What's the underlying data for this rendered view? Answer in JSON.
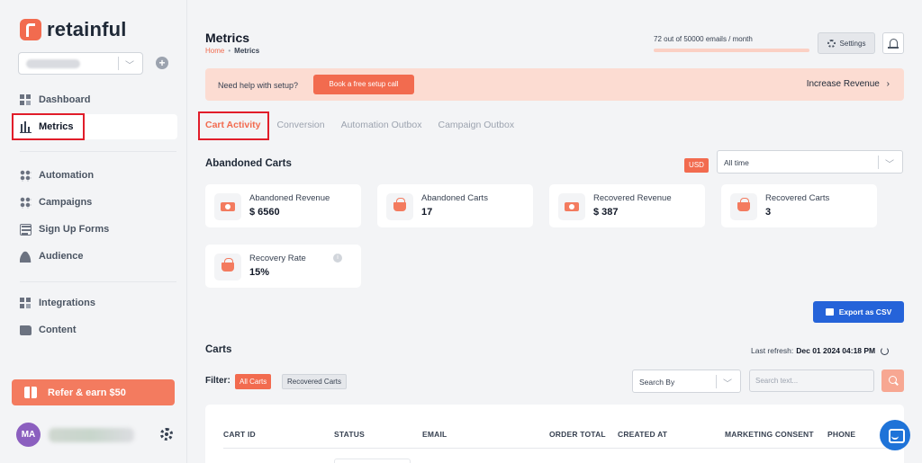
{
  "app": {
    "name": "retainful"
  },
  "sidebar": {
    "items": [
      {
        "label": "Dashboard",
        "icon": "dashboard-icon"
      },
      {
        "label": "Metrics",
        "icon": "bar-chart-icon"
      },
      {
        "label": "Automation",
        "icon": "automation-icon"
      },
      {
        "label": "Campaigns",
        "icon": "campaigns-icon"
      },
      {
        "label": "Sign Up Forms",
        "icon": "form-icon"
      },
      {
        "label": "Audience",
        "icon": "audience-icon"
      },
      {
        "label": "Integrations",
        "icon": "integrations-icon"
      },
      {
        "label": "Content",
        "icon": "folder-icon"
      }
    ],
    "refer_label": "Refer & earn $50",
    "user_initials": "MA"
  },
  "header": {
    "title": "Metrics",
    "breadcrumb": {
      "home": "Home",
      "separator": "•",
      "current": "Metrics"
    },
    "usage_text": "72 out of 50000 emails / month",
    "usage_fraction": 0.00144,
    "settings_label": "Settings"
  },
  "banner": {
    "help_text": "Need help with setup?",
    "book_label": "Book a free setup call",
    "increase_label": "Increase Revenue",
    "increase_arrow": "›"
  },
  "tabs": [
    {
      "label": "Cart Activity",
      "active": true
    },
    {
      "label": "Conversion",
      "active": false
    },
    {
      "label": "Automation Outbox",
      "active": false
    },
    {
      "label": "Campaign Outbox",
      "active": false
    }
  ],
  "abandoned": {
    "title": "Abandoned Carts",
    "currency": "USD",
    "time_range": "All time",
    "cards": [
      {
        "label": "Abandoned Revenue",
        "value": "$ 6560",
        "icon": "money-icon"
      },
      {
        "label": "Abandoned Carts",
        "value": "17",
        "icon": "basket-icon"
      },
      {
        "label": "Recovered Revenue",
        "value": "$ 387",
        "icon": "money-icon"
      },
      {
        "label": "Recovered Carts",
        "value": "3",
        "icon": "basket-icon"
      },
      {
        "label": "Recovery Rate",
        "value": "15%",
        "icon": "basket-icon",
        "info": "i"
      }
    ]
  },
  "export_label": "Export as CSV",
  "carts": {
    "title": "Carts",
    "last_refresh_label": "Last refresh:",
    "last_refresh_value": "Dec 01 2024 04:18 PM",
    "filter_label": "Filter:",
    "filters": [
      "All Carts",
      "Recovered Carts"
    ],
    "search_by": "Search By",
    "search_placeholder": "Search text...",
    "columns": [
      "CART ID",
      "STATUS",
      "EMAIL",
      "ORDER TOTAL",
      "CREATED AT",
      "MARKETING CONSENT",
      "PHONE"
    ]
  },
  "colors": {
    "accent": "#f26b4f",
    "primary_blue": "#2563d9",
    "highlight_box": "#e11d2a"
  }
}
